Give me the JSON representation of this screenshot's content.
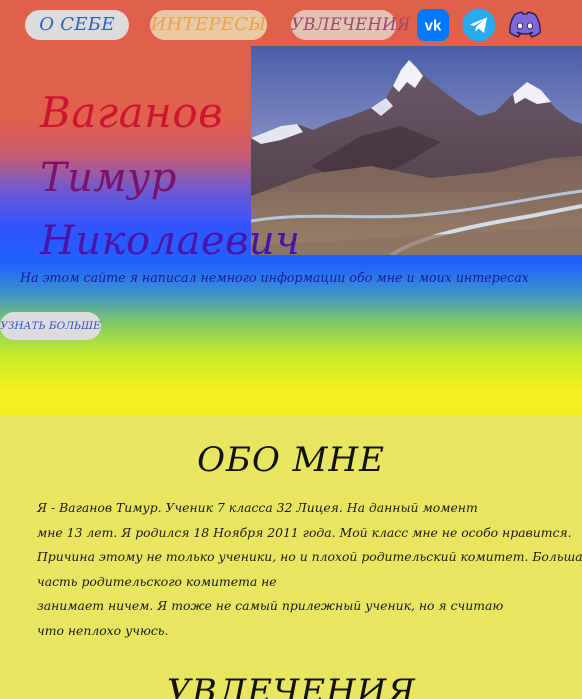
{
  "nav": {
    "about": "О СЕБЕ",
    "interests": "ИНТЕРЕСЫ",
    "hobbies": "УВЛЕЧЕНИЯ"
  },
  "social": {
    "vk": "vk-icon",
    "telegram": "telegram-icon",
    "discord": "discord-icon"
  },
  "hero": {
    "name_line_1": "Ваганов",
    "name_line_2": "Тимур",
    "name_line_3": "Николаевич",
    "tagline": "На этом сайте я написал немного информации обо мне и моих интересах",
    "learn_more": "УЗНАТЬ БОЛЬШЕ"
  },
  "about": {
    "title": "ОБО МНЕ",
    "lines": [
      "Я - Ваганов Тимур. Ученик 7 класса 32 Лицея. На данный момент",
      "мне 13 лет. Я родился 18 Ноября 2011 года. Мой класс мне не особо нравится.",
      "Причина этому не только ученики, но и плохой родительский комитет. Большая",
      "часть родительского комитета не",
      "занимает ничем. Я тоже не самый прилежный ученик, но я считаю",
      "что неплохо учюсь."
    ]
  },
  "hobbies": {
    "title": "УВЛЕЧЕНИЯ"
  },
  "colors": {
    "name_red": "#cc1630",
    "name_purple": "#7a126e",
    "name_violet": "#4a14a8",
    "about_bg": "#e8e561",
    "vk": "#0077ff",
    "telegram": "#2aabee",
    "discord": "#7e67d8"
  }
}
